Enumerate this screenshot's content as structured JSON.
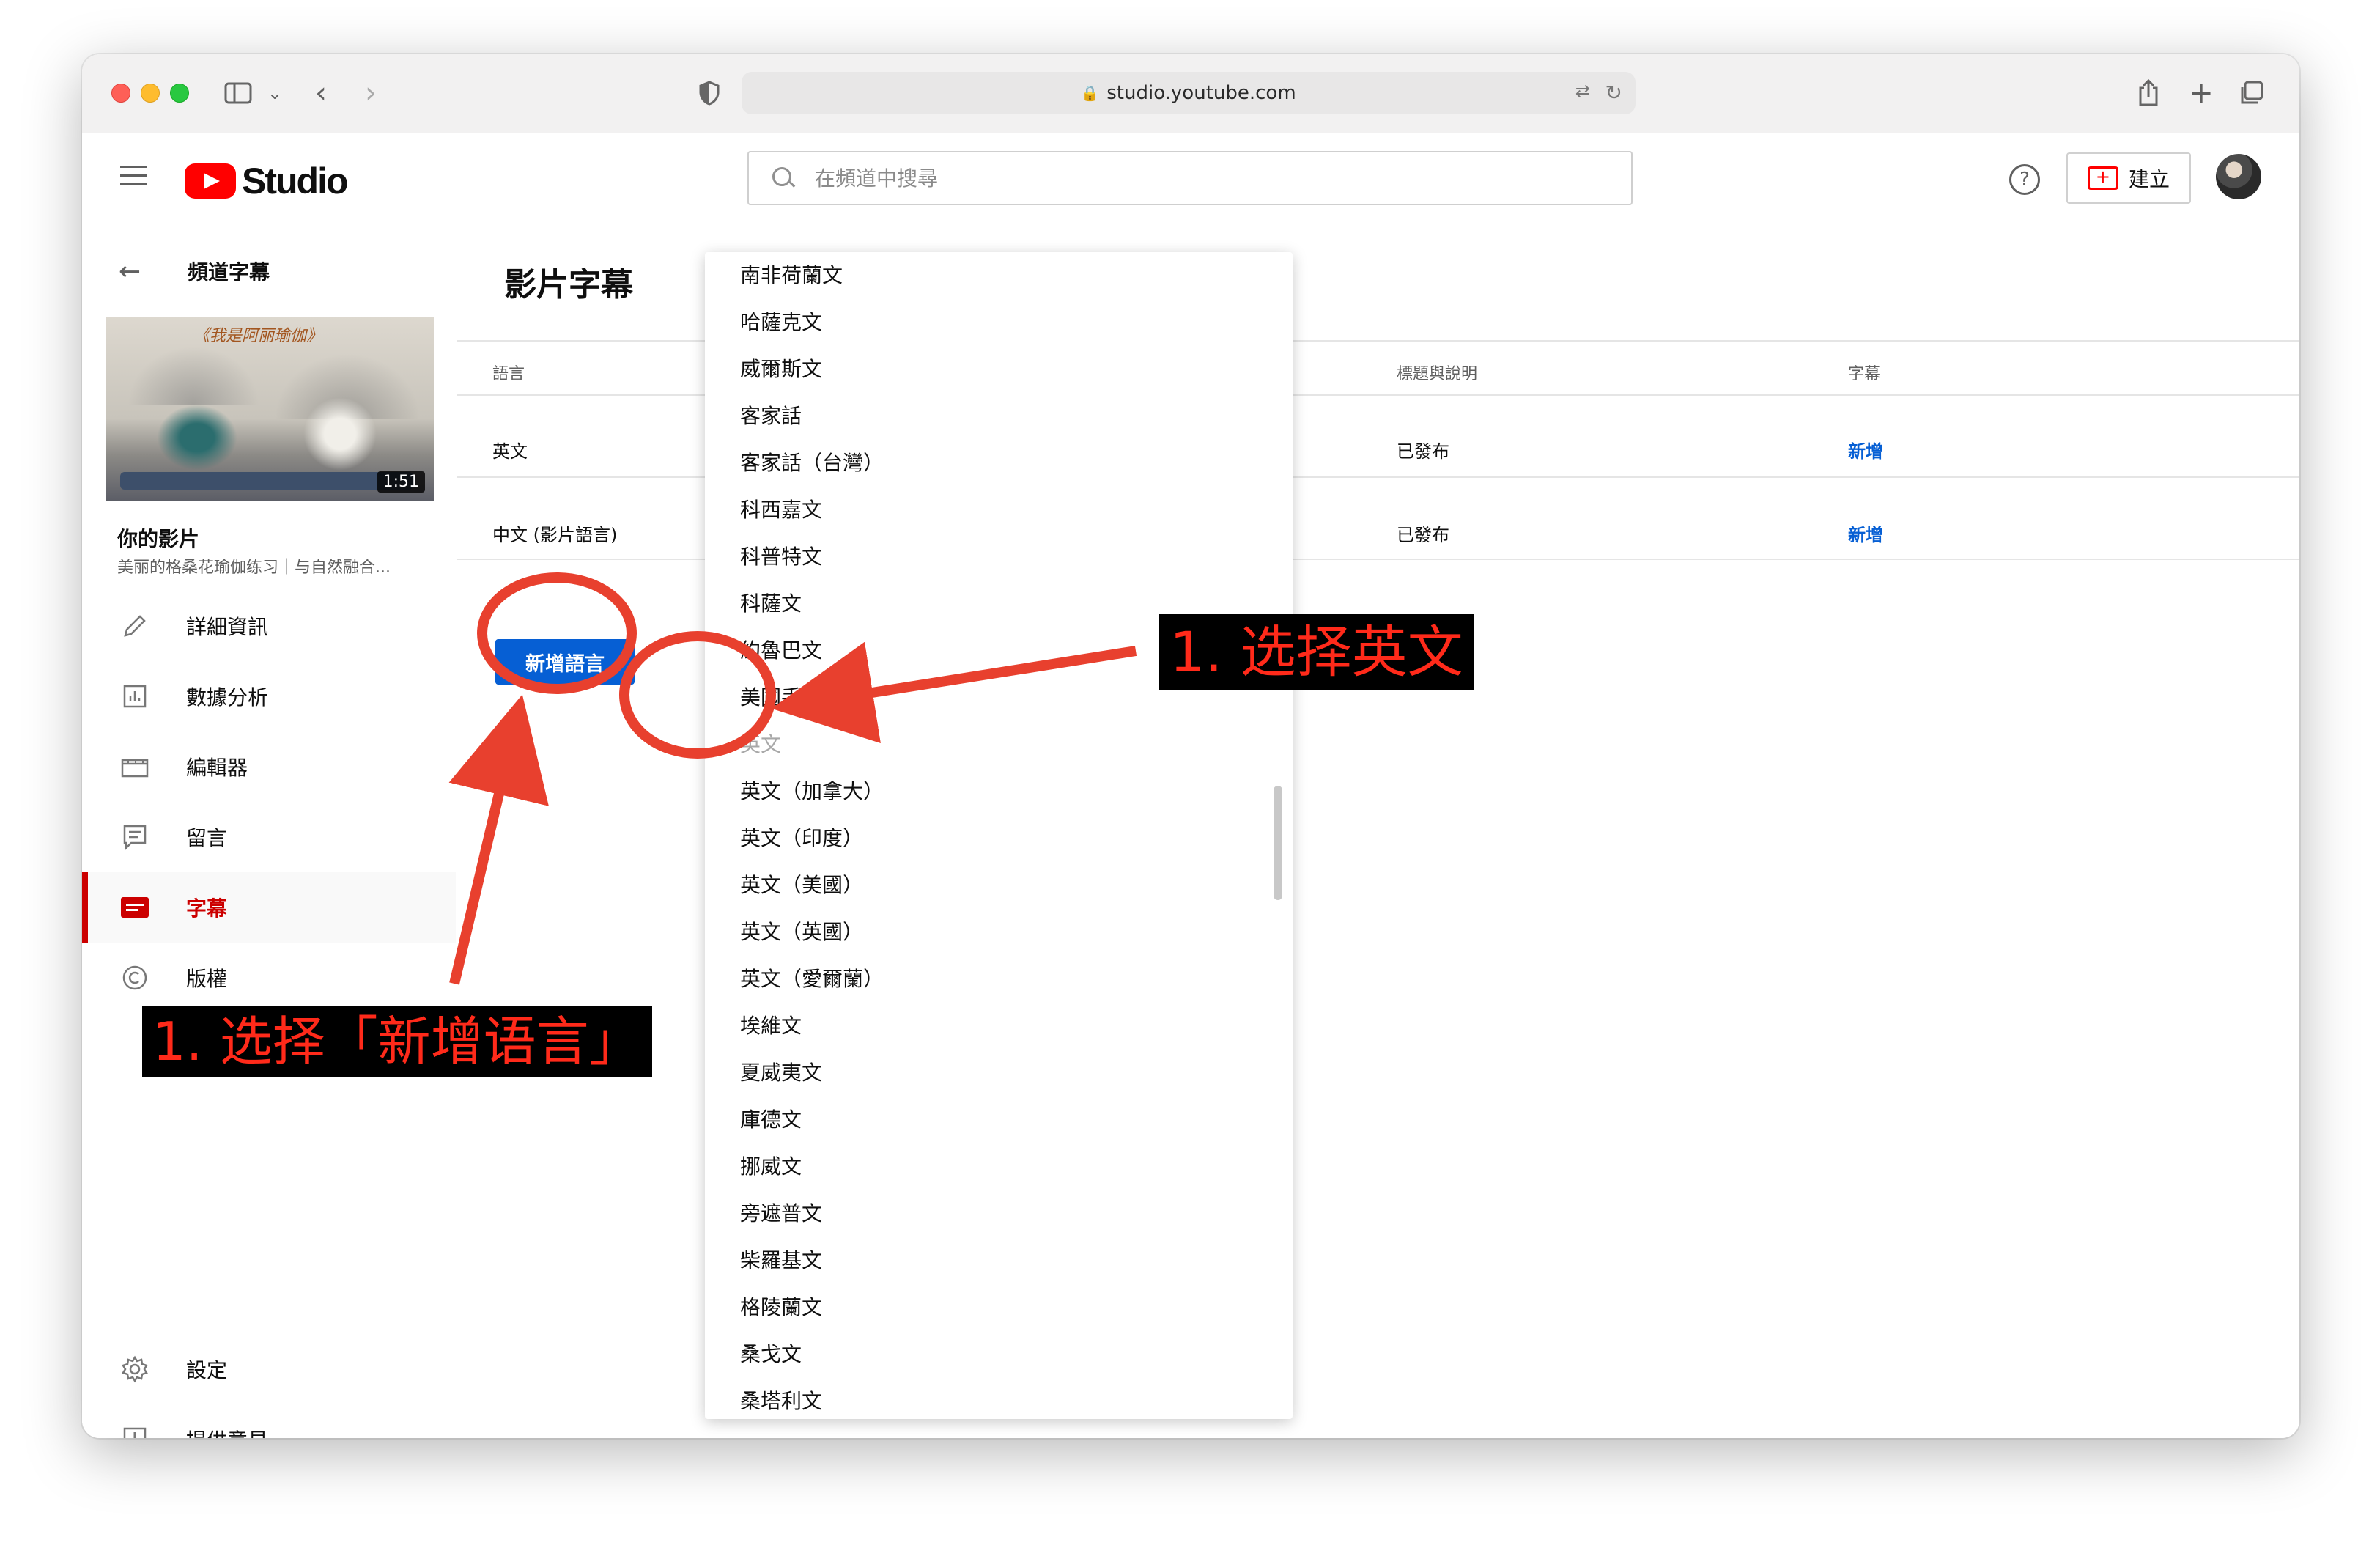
{
  "browser": {
    "url": "studio.youtube.com"
  },
  "header": {
    "logo_text": "Studio",
    "search_placeholder": "在頻道中搜尋",
    "help_glyph": "?",
    "create_label": "建立"
  },
  "sidebar": {
    "title": "頻道字幕",
    "video_duration": "1:51",
    "thumbnail_caption": "《我是阿丽瑜伽》",
    "your_video_label": "你的影片",
    "video_title": "美丽的格桑花瑜伽练习｜与自然融合...",
    "items": [
      {
        "label": "詳細資訊",
        "icon": "pencil-icon"
      },
      {
        "label": "數據分析",
        "icon": "analytics-icon"
      },
      {
        "label": "編輯器",
        "icon": "editor-icon"
      },
      {
        "label": "留言",
        "icon": "comments-icon"
      },
      {
        "label": "字幕",
        "icon": "subtitles-icon",
        "active": true
      },
      {
        "label": "版權",
        "icon": "copyright-icon"
      }
    ],
    "bottom_items": [
      {
        "label": "設定",
        "icon": "gear-icon"
      },
      {
        "label": "提供意見",
        "icon": "feedback-icon"
      }
    ]
  },
  "main": {
    "page_title": "影片字幕",
    "columns": {
      "language": "語言",
      "title_desc": "標題與說明",
      "subtitles": "字幕"
    },
    "rows": [
      {
        "language": "英文",
        "title_desc": "已發布",
        "subtitles": "新增"
      },
      {
        "language": "中文 (影片語言)",
        "title_desc": "已發布",
        "subtitles": "新增"
      }
    ],
    "add_language_button": "新增語言"
  },
  "language_dropdown": {
    "items": [
      {
        "label": "南非荷蘭文"
      },
      {
        "label": "哈薩克文"
      },
      {
        "label": "威爾斯文"
      },
      {
        "label": "客家話"
      },
      {
        "label": "客家話（台灣）"
      },
      {
        "label": "科西嘉文"
      },
      {
        "label": "科普特文"
      },
      {
        "label": "科薩文"
      },
      {
        "label": "約魯巴文"
      },
      {
        "label": "美國手語"
      },
      {
        "label": "英文",
        "disabled": true
      },
      {
        "label": "英文（加拿大）"
      },
      {
        "label": "英文（印度）"
      },
      {
        "label": "英文（美國）"
      },
      {
        "label": "英文（英國）"
      },
      {
        "label": "英文（愛爾蘭）"
      },
      {
        "label": "埃維文"
      },
      {
        "label": "夏威夷文"
      },
      {
        "label": "庫德文"
      },
      {
        "label": "挪威文"
      },
      {
        "label": "旁遮普文"
      },
      {
        "label": "柴羅基文"
      },
      {
        "label": "格陵蘭文"
      },
      {
        "label": "桑戈文"
      },
      {
        "label": "桑塔利文"
      }
    ]
  },
  "annotations": {
    "select_english": "1. 选择英文",
    "select_add_language": "1. 选择「新增语言」",
    "color": "#e8402e"
  }
}
